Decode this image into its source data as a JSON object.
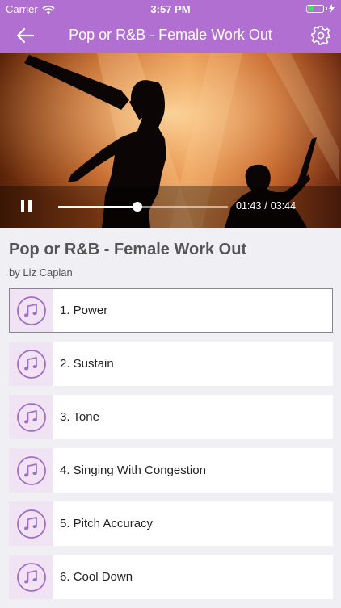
{
  "status_bar": {
    "carrier": "Carrier",
    "time": "3:57 PM",
    "battery_level": 0.4
  },
  "nav": {
    "title": "Pop or R&B - Female Work Out"
  },
  "player": {
    "state": "playing",
    "progress": 0.465,
    "current_time": "01:43",
    "separator": "/",
    "total_time": "03:44"
  },
  "album": {
    "title": "Pop or R&B - Female Work Out",
    "author": "by Liz Caplan"
  },
  "tracks": [
    {
      "label": "1. Power",
      "selected": true
    },
    {
      "label": "2. Sustain",
      "selected": false
    },
    {
      "label": "3. Tone",
      "selected": false
    },
    {
      "label": "4. Singing With Congestion",
      "selected": false
    },
    {
      "label": "5. Pitch Accuracy",
      "selected": false
    },
    {
      "label": "6. Cool Down",
      "selected": false
    }
  ],
  "colors": {
    "accent": "#b06fd1",
    "icon": "#a46cc4",
    "battery": "#4cd964"
  },
  "icons": [
    "wifi-icon",
    "battery-icon",
    "back-arrow-icon",
    "gear-icon",
    "pause-icon",
    "music-note-icon"
  ]
}
